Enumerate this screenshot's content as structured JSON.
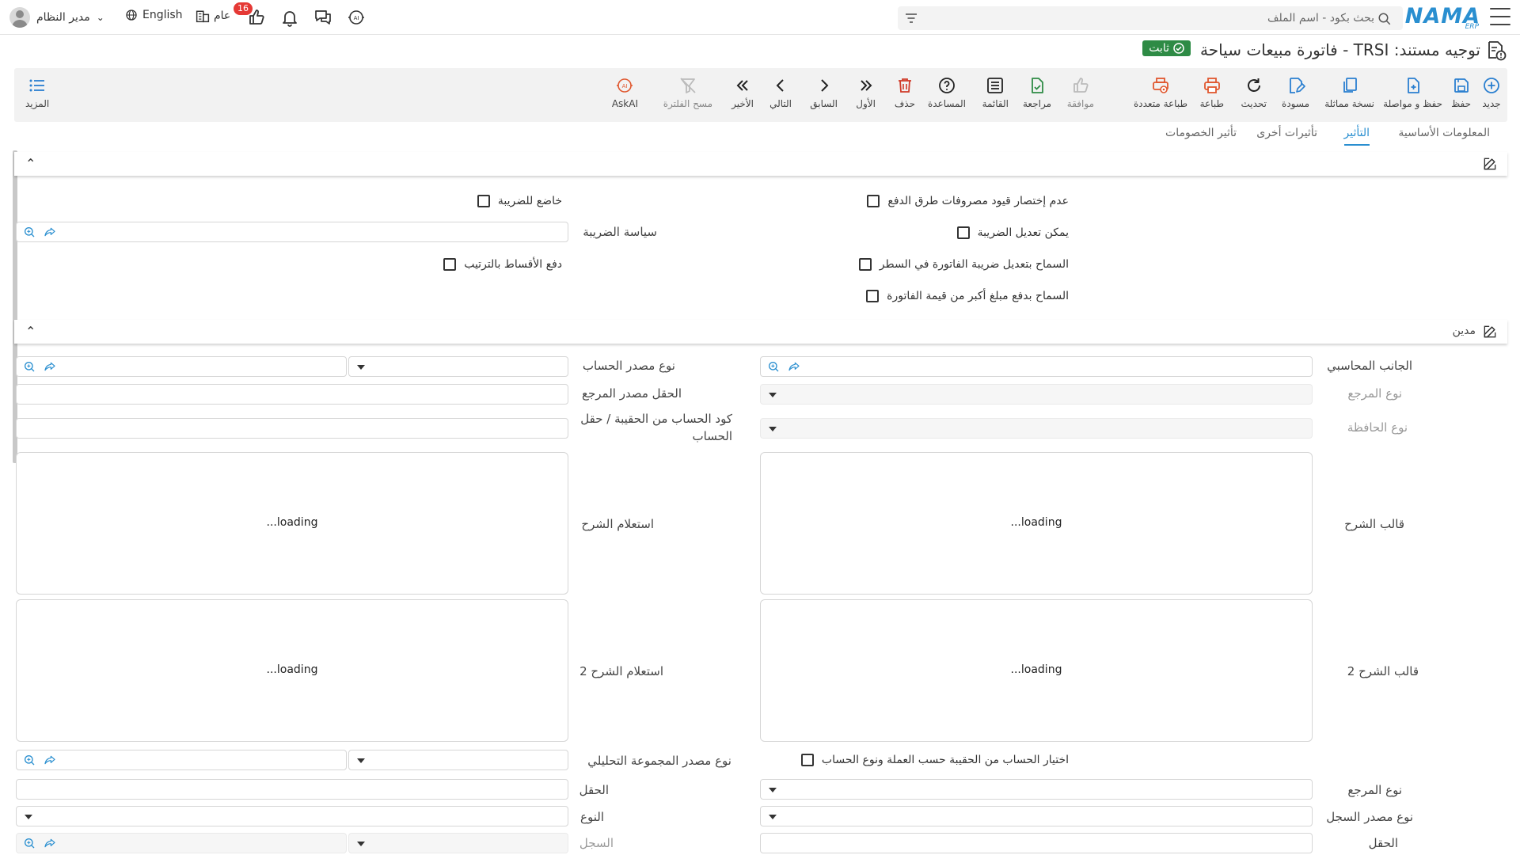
{
  "header": {
    "search_placeholder": "بحث بكود - اسم الملف",
    "user_name": "مدير النظام",
    "language": "English",
    "general": "عام",
    "notifications_badge": "16",
    "logo_text": "NAMA",
    "logo_sub": "ERP"
  },
  "title": {
    "text": "توجيه مستند: TRSI - فاتورة مبيعات سياحة",
    "status": "ثابت"
  },
  "toolbar": {
    "new": "جديد",
    "save": "حفظ",
    "save_continue": "حفظ و مواصلة",
    "duplicate": "نسخة مماثلة",
    "draft": "مسودة",
    "refresh": "تحديث",
    "print": "طباعة",
    "multi_print": "طباعة متعددة",
    "approve": "موافقة",
    "review": "مراجعة",
    "list": "القائمة",
    "help": "المساعدة",
    "delete": "حذف",
    "first": "الأول",
    "previous": "السابق",
    "next": "التالي",
    "last": "الأخير",
    "clear_filter": "مسح الفلترة",
    "askai": "AskAI",
    "more": "المزيد"
  },
  "tabs": [
    "المعلومات الأساسية",
    "التأثير",
    "تأثيرات أخرى",
    "تأثير الخصومات"
  ],
  "section1": {
    "cb_no_shorten": "عدم إختصار قيود مصروفات طرق الدفع",
    "cb_edit_tax": "يمكن تعديل الضريبة",
    "cb_edit_invoice_tax_line": "السماح بتعديل ضريبة الفاتورة في السطر",
    "cb_pay_more": "السماح بدفع مبلغ أكبر من قيمة الفاتورة",
    "cb_taxable": "خاضع للضريبة",
    "tax_policy": "سياسة الضريبة",
    "cb_installments": "دفع الأقساط بالترتيب"
  },
  "section2": {
    "title": "مدين",
    "accounting_side": "الجانب المحاسبي",
    "ref_type": "نوع المرجع",
    "wallet_type": "نوع الحافظة",
    "account_source_type": "نوع مصدر الحساب",
    "ref_source_field": "الحقل مصدر المرجع",
    "account_code_from_bag": "كود الحساب من الحقيبة / حقل الحساب",
    "narration_template": "قالب الشرح",
    "narration_query": "استعلام الشرح",
    "narration_template_2": "قالب الشرح 2",
    "narration_query_2": "استعلام الشرح 2",
    "loading": "loading...",
    "cb_pick_account": "اختيار الحساب من الحقيبة حسب العملة ونوع الحساب",
    "analytic_source_type": "نوع مصدر المجموعة التحليلي",
    "ref_type_2": "نوع المرجع",
    "field": "الحقل",
    "record_source_type": "نوع مصدر السجل",
    "type": "النوع",
    "field_2": "الحقل",
    "record": "السجل"
  }
}
